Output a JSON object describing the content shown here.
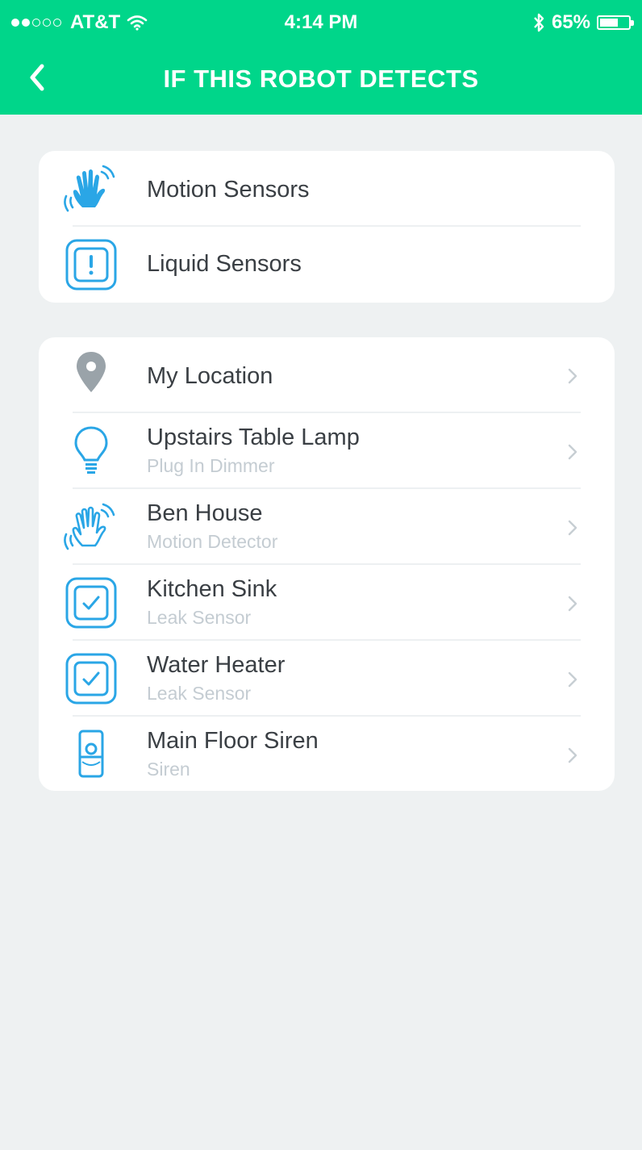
{
  "status_bar": {
    "carrier": "AT&T",
    "signal_bars": 2,
    "signal_total": 5,
    "time": "4:14 PM",
    "battery_percent": "65%",
    "battery_level": 0.65
  },
  "nav": {
    "back_icon": "chevron-left-icon",
    "title": "IF THIS ROBOT DETECTS"
  },
  "colors": {
    "header": "#00d68a",
    "icon_blue": "#2aa6e6",
    "icon_gray": "#9aa3a9",
    "background": "#eef1f2"
  },
  "sensor_types": [
    {
      "label": "Motion Sensors",
      "icon": "waving-hand-icon"
    },
    {
      "label": "Liquid Sensors",
      "icon": "liquid-sensor-alert-icon"
    }
  ],
  "devices": [
    {
      "label": "My Location",
      "subtitle": "",
      "icon": "location-pin-icon"
    },
    {
      "label": "Upstairs Table Lamp",
      "subtitle": "Plug In Dimmer",
      "icon": "light-bulb-icon"
    },
    {
      "label": "Ben House",
      "subtitle": "Motion Detector",
      "icon": "waving-hand-icon"
    },
    {
      "label": "Kitchen Sink",
      "subtitle": "Leak Sensor",
      "icon": "leak-sensor-check-icon"
    },
    {
      "label": "Water Heater",
      "subtitle": "Leak Sensor",
      "icon": "leak-sensor-check-icon"
    },
    {
      "label": "Main Floor Siren",
      "subtitle": "Siren",
      "icon": "siren-icon"
    }
  ]
}
